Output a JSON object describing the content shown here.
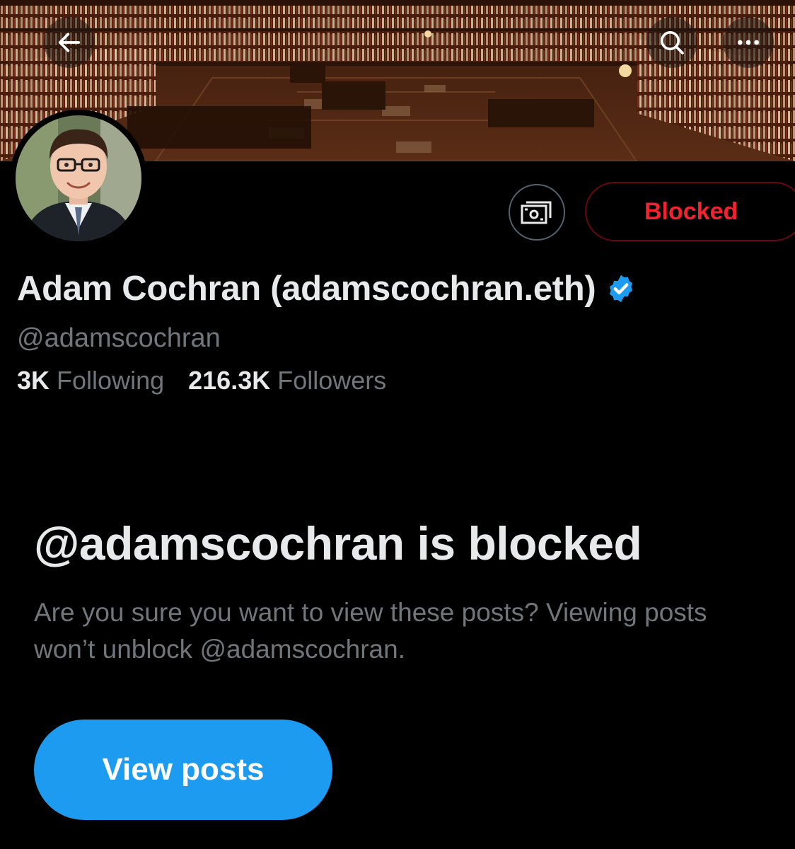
{
  "header": {
    "back_icon": "arrow-left-icon",
    "search_icon": "search-icon",
    "more_icon": "more-horizontal-icon"
  },
  "profile": {
    "display_name": "Adam Cochran (adamscochran.eth)",
    "handle": "@adamscochran",
    "verified": true,
    "verified_color": "#1d9bf0",
    "following_count": "3K",
    "following_label": "Following",
    "followers_count": "216.3K",
    "followers_label": "Followers"
  },
  "actions": {
    "tip_icon": "money-tip-icon",
    "blocked_label": "Blocked",
    "blocked_color": "#f4212e"
  },
  "blocked_notice": {
    "title": "@adamscochran is blocked",
    "description": "Are you sure you want to view these posts? Viewing posts won’t unblock @adamscochran.",
    "button_label": "View posts",
    "button_color": "#1d9bf0"
  }
}
